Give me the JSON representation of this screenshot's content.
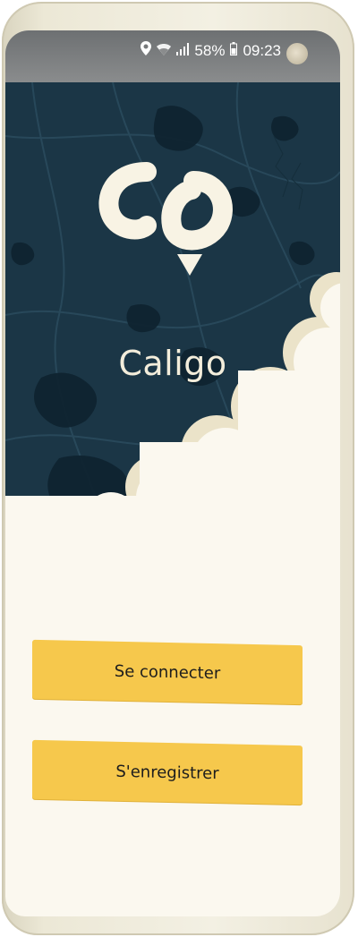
{
  "status_bar": {
    "battery": "58%",
    "time": "09:23",
    "icons": [
      "location-icon",
      "wifi-icon",
      "signal-icon",
      "battery-icon"
    ]
  },
  "app": {
    "name": "Caligo"
  },
  "actions": {
    "login_label": "Se connecter",
    "register_label": "S'enregistrer"
  },
  "colors": {
    "map_background": "#1b3646",
    "cloud": "#fbf8ef",
    "button": "#f6c84c",
    "phone_body": "#ece8d6"
  }
}
